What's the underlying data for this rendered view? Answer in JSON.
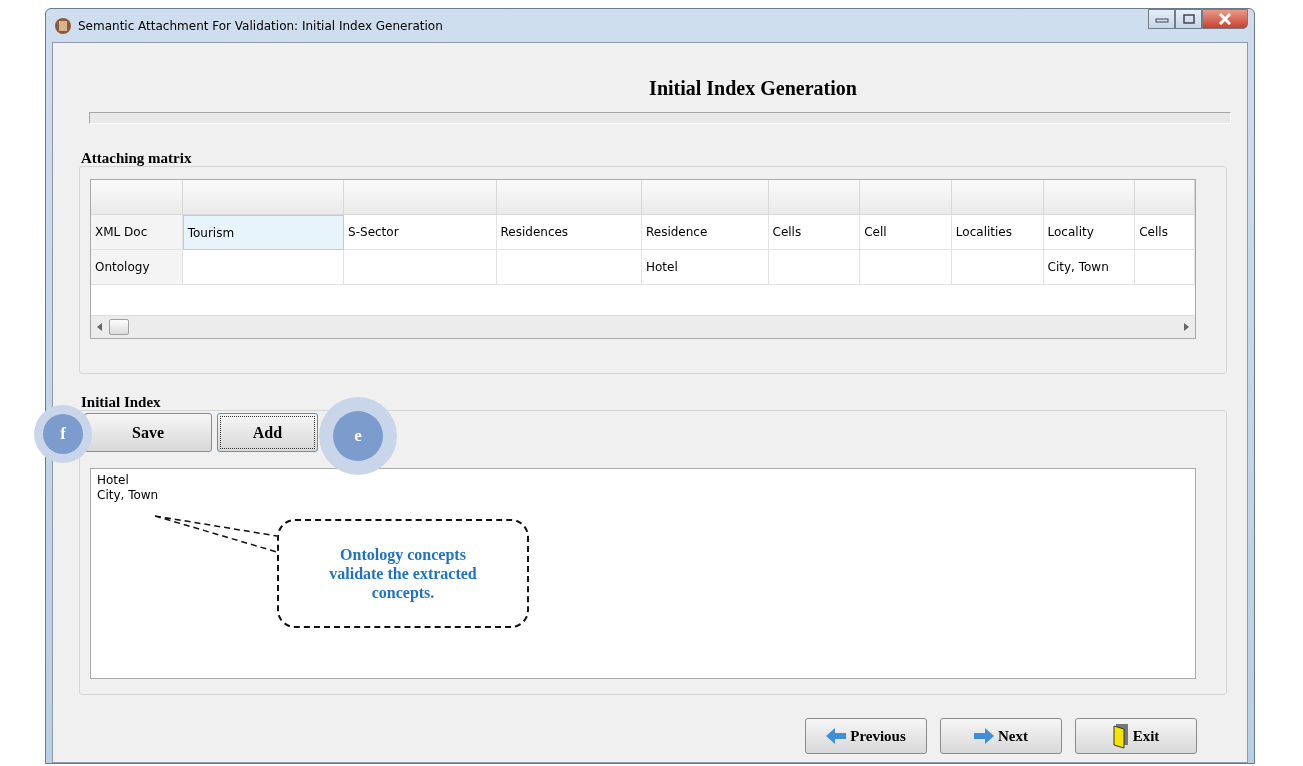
{
  "window": {
    "title": "Semantic Attachment For Validation: Initial Index Generation"
  },
  "heading": "Initial Index Generation",
  "progress": {
    "level": 0
  },
  "matrix": {
    "title": "Attaching matrix",
    "rows": [
      {
        "cells": [
          {
            "text": "XML Doc",
            "selected": false
          },
          {
            "text": "Tourism",
            "selected": true
          },
          {
            "text": "S-Sector",
            "selected": false
          },
          {
            "text": "Residences",
            "selected": false
          },
          {
            "text": "Residence",
            "selected": false
          },
          {
            "text": "Cells",
            "selected": false
          },
          {
            "text": "Cell",
            "selected": false
          },
          {
            "text": "Localities",
            "selected": false
          },
          {
            "text": "Locality",
            "selected": false
          },
          {
            "text": "Cells",
            "selected": false
          }
        ]
      },
      {
        "cells": [
          {
            "text": "Ontology",
            "selected": false
          },
          {
            "selected": false
          },
          {
            "selected": false
          },
          {
            "selected": false
          },
          {
            "text": "Hotel",
            "selected": false
          },
          {
            "selected": false
          },
          {
            "selected": false
          },
          {
            "selected": false
          },
          {
            "text": "City, Town",
            "selected": false
          },
          {
            "selected": false
          }
        ]
      }
    ]
  },
  "index": {
    "title": "Initial Index",
    "buttons": [
      {
        "label": "Save",
        "focused": false
      },
      {
        "label": "Add",
        "focused": true
      }
    ],
    "lines": [
      "Hotel",
      "City, Town"
    ]
  },
  "annotations": {
    "markers": [
      "f",
      "e"
    ],
    "callout": "Ontology concepts validate the extracted concepts."
  },
  "nav_buttons": [
    {
      "kind": "previous",
      "label": "Previous"
    },
    {
      "kind": "next",
      "label": "Next"
    },
    {
      "kind": "exit",
      "label": "Exit"
    }
  ]
}
